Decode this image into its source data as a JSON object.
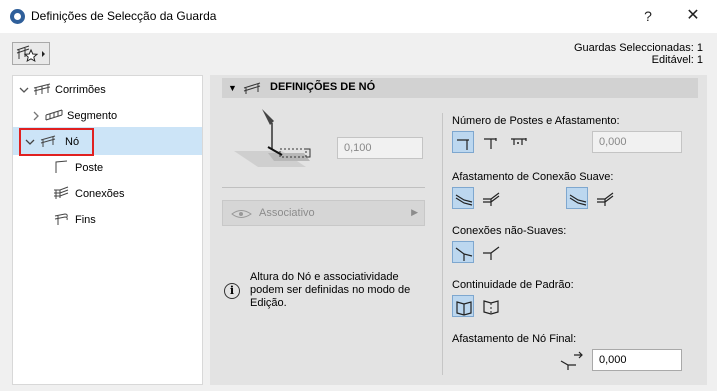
{
  "window": {
    "title": "Definições de Selecção da Guarda",
    "help_label": "?",
    "close_label": "✕"
  },
  "selection_info": {
    "line1": "Guardas Seleccionadas: 1",
    "line2": "Editável: 1"
  },
  "tree": {
    "items": [
      {
        "label": "Corrimões",
        "icon": "railing-icon"
      },
      {
        "label": "Segmento",
        "icon": "segment-icon"
      },
      {
        "label": "Nó",
        "icon": "node-icon"
      },
      {
        "label": "Poste",
        "icon": "post-icon"
      },
      {
        "label": "Conexões",
        "icon": "connections-icon"
      },
      {
        "label": "Fins",
        "icon": "ends-icon"
      }
    ]
  },
  "section": {
    "title": "DEFINIÇÕES DE NÓ",
    "height_value": "0,100",
    "associative_label": "Associativo",
    "info_text": "Altura do Nó e associatividade podem ser definidas no modo de Edição.",
    "posts_label": "Número de Postes e Afastamento:",
    "posts_value": "0,000",
    "smooth_label": "Afastamento de Conexão Suave:",
    "nonsmooth_label": "Conexões não-Suaves:",
    "pattern_label": "Continuidade de Padrão:",
    "endnode_label": "Afastamento de Nó Final:",
    "endnode_value": "0,000"
  },
  "colors": {
    "selection": "#cce4f7",
    "highlight_border": "#e02020",
    "toggle_on": "#bcd7ef"
  }
}
